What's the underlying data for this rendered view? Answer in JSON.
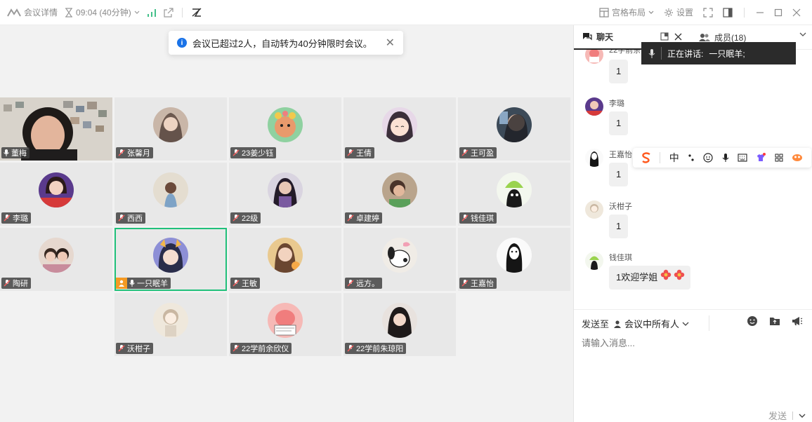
{
  "topbar": {
    "meeting_details": "会议详情",
    "timer": "09:04 (40分钟)",
    "layout_label": "宫格布局",
    "settings_label": "设置"
  },
  "toast": {
    "text": "会议已超过2人，自动转为40分钟限时会议。"
  },
  "participants": [
    "董梅",
    "张馨月",
    "23姜少钰",
    "王倩",
    "王可盈",
    "李璐",
    "西西",
    "22级",
    "卓建婷",
    "钱佳琪",
    "陶研",
    "一只眠羊",
    "王敏",
    "远方。",
    "王嘉怡",
    "沃柑子",
    "22学前余欣仪",
    "22学前朱琼阳"
  ],
  "panel": {
    "chat_tab": "聊天",
    "members_tab": "成员(18)",
    "speaking_label": "正在讲话:",
    "speaking_name": "一只眠羊;",
    "partial_sender": "22学前余",
    "messages": [
      {
        "sender": "",
        "text": "1"
      },
      {
        "sender": "李璐",
        "text": "1"
      },
      {
        "sender": "王嘉怡",
        "text": "1"
      },
      {
        "sender": "沃柑子",
        "text": "1"
      },
      {
        "sender": "钱佳琪",
        "text": "1欢迎学姐"
      }
    ],
    "floatbar_zh": "中",
    "send_to_label": "发送至",
    "send_to_target": "会议中所有人",
    "input_placeholder": "请输入消息...",
    "send_label": "发送"
  },
  "colors": {
    "accent_green": "#20c07a",
    "host_badge": "#f59a23",
    "info_blue": "#1a73e8"
  }
}
